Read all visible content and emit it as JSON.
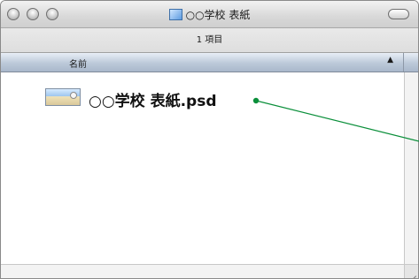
{
  "window": {
    "title": "○○学校 表紙",
    "item_count": "1 項目"
  },
  "list_header": {
    "name_column": "名前",
    "sort_indicator": "▲"
  },
  "files": [
    {
      "name": "○○学校 表紙.psd"
    }
  ],
  "colors": {
    "annotation_line": "#0a8f3a"
  }
}
